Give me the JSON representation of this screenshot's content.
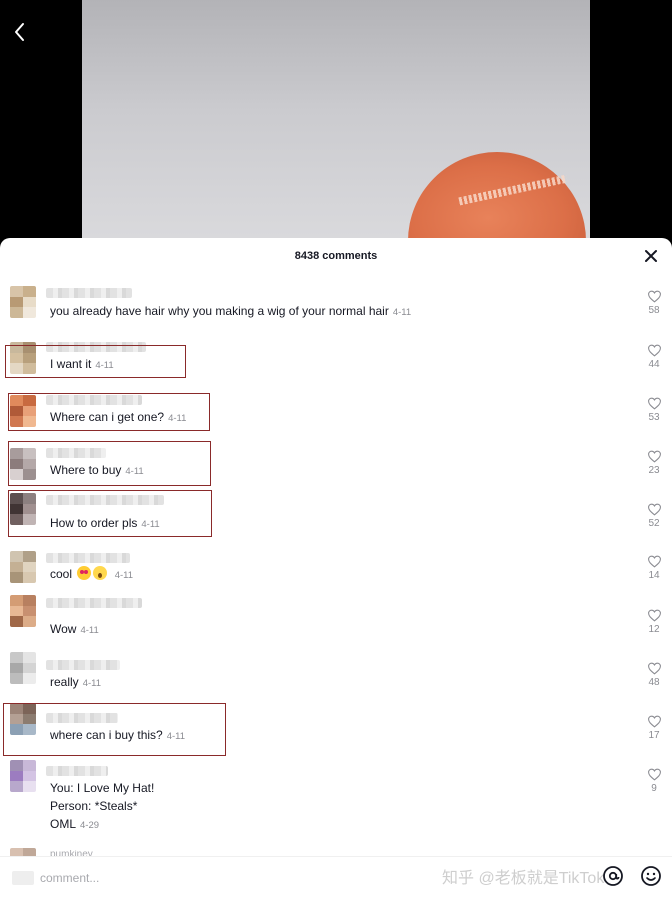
{
  "header": {
    "comment_count": "8438 comments"
  },
  "comments": [
    {
      "text": "you already have hair why you making a wig of your normal hair",
      "date": "4-11",
      "likes": "58"
    },
    {
      "text": "I want it",
      "date": "4-11",
      "likes": "44",
      "highlighted": true
    },
    {
      "text": "Where can i get one?",
      "date": "4-11",
      "likes": "53",
      "highlighted": true
    },
    {
      "text": "Where to buy",
      "date": "4-11",
      "likes": "23",
      "highlighted": true
    },
    {
      "text": "How to order pls",
      "date": "4-11",
      "likes": "52",
      "highlighted": true
    },
    {
      "text": "cool",
      "date": "4-11",
      "likes": "14"
    },
    {
      "text": "Wow",
      "date": "4-11",
      "likes": "12"
    },
    {
      "text": "really",
      "date": "4-11",
      "likes": "48"
    },
    {
      "text": "where can i buy this?",
      "date": "4-11",
      "likes": "17",
      "highlighted": true
    },
    {
      "lines": [
        "You: I Love My Hat!",
        "Person: *Steals*",
        "OML"
      ],
      "date": "4-29",
      "likes": "9"
    }
  ],
  "partial_username": "pumkiney",
  "footer": {
    "placeholder": "comment...",
    "watermark": "知乎 @老板就是TikTok"
  },
  "icons": {
    "back": "chevron-left-icon",
    "close": "close-icon",
    "like": "heart-outline-icon",
    "mention": "at-sign-icon",
    "emoji": "smiley-icon"
  },
  "colors": {
    "highlight_box": "#8a2a2a",
    "text": "#161823",
    "muted": "#8a8b91",
    "cap": "#dc6f48"
  }
}
